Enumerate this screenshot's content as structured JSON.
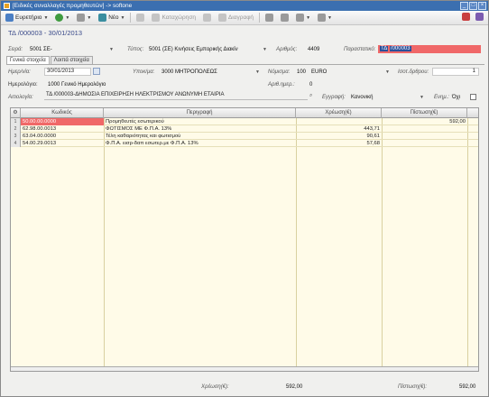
{
  "window": {
    "title": "[Ειδικές συναλλαγές προμηθευτών] -> softone"
  },
  "toolbar": {
    "items": [
      {
        "label": "Ευρετήριο",
        "icon": "index-icon"
      },
      {
        "label": "",
        "icon": "add-icon"
      },
      {
        "label": "",
        "icon": "print-icon"
      },
      {
        "label": "Νέο",
        "icon": "new-icon"
      },
      {
        "label": "",
        "icon": "copy-icon"
      },
      {
        "label": "Καταχώρηση",
        "icon": "save-icon"
      },
      {
        "label": "",
        "icon": "undo-icon"
      },
      {
        "label": "Διαγραφή",
        "icon": "delete-icon"
      }
    ]
  },
  "doc": {
    "header": "ΤΔ   /000003  - 30/01/2013"
  },
  "fields": {
    "series_label": "Σειρά:",
    "series_value": "5001   ΣΕ-",
    "type_label": "Τύπος:",
    "type_value": "5001  (ΣΕ) Κινήσεις Εμπορικής Διακίν",
    "number_label": "Αριθμός:",
    "number_value": "4409",
    "doc_label": "Παραστατικό:",
    "doc_prefix": "ΤΔ",
    "doc_value": "/000003",
    "date_label": "Ημερ/νία:",
    "date_value": "30/01/2013",
    "branch_label": "Υποκ/μα:",
    "branch_value": "3000   ΜΗΤΡΟΠΟΛΕΩΣ",
    "currency_label": "Νόμισμα:",
    "currency_code": "100",
    "currency_value": "EURO",
    "rate_label": "Ισοτ.δρθρου:",
    "rate_value": "1",
    "journal_label": "Ημερολόγιο:",
    "journal_value": "1000   Γενικό Ημερολόγιο",
    "entry_label": "Αριθ.ημερ.:",
    "entry_value": "0",
    "reason_label": "Αιτιολογία:",
    "reason_value": "ΤΔ   /000003-ΔΗΜΟΣΙΑ ΕΠΙΧΕΙΡΗΣΗ ΗΛΕΚΤΡΙΣΜΟΥ ΑΝΩΝΥΜΗ ΕΤΑΙΡΙΑ",
    "record_label": "Εγγραφή:",
    "record_value": "Κανονική",
    "update_label": "Ενημ.:",
    "update_value": "Όχι"
  },
  "tabs": [
    "Γενικά στοιχεία",
    "Λοιπά στοιχεία"
  ],
  "grid": {
    "columns": [
      "Κωδικός",
      "Περιγραφή",
      "Χρέωση(€)",
      "Πίστωση(€)"
    ],
    "rows": [
      {
        "num": "1",
        "code": "50.00.00.0000",
        "desc": "Προμηθευτές  εσωτερικού",
        "debit": "",
        "credit": "592,00"
      },
      {
        "num": "2",
        "code": "62.98.00.0013",
        "desc": "ΦΩΤΙΣΜΟΣ ΜΕ Φ.Π.Α. 13%",
        "debit": "443,71",
        "credit": ""
      },
      {
        "num": "3",
        "code": "63.04.00.0000",
        "desc": "Τέλη καθαριότητας και φωτισμού",
        "debit": "90,61",
        "credit": ""
      },
      {
        "num": "4",
        "code": "54.00.29.0013",
        "desc": "Φ.Π.Α. εισρ-δαπ εσωτερ.με Φ.Π.Α. 13%",
        "debit": "57,68",
        "credit": ""
      }
    ]
  },
  "totals": {
    "debit_label": "Χρέωση(€):",
    "debit_value": "592,00",
    "credit_label": "Πίστωση(€):",
    "credit_value": "592,00"
  },
  "colors": {
    "title_bar": "#3b6fb0",
    "grid_bg": "#fffbe8",
    "highlight": "#f06868",
    "selection": "#2a4f9a"
  }
}
